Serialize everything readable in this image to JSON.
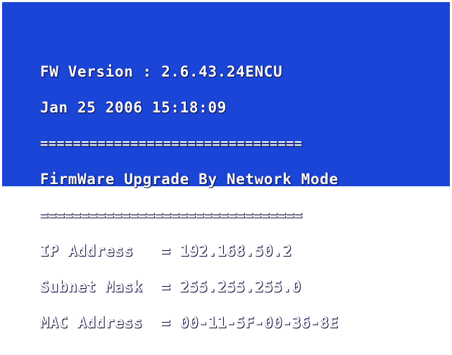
{
  "colors": {
    "background": "#1a45d6",
    "text": "#ffffff",
    "frame": "#ffffff"
  },
  "console": {
    "lines": {
      "fw_version": "FW Version : 2.6.43.24ENCU",
      "timestamp": "Jan 25 2006 15:18:09",
      "divider_top": "================================",
      "mode_title": "FirmWare Upgrade By Network Mode",
      "divider_bottom": "================================",
      "ip_address": "IP Address   = 192.168.50.2",
      "subnet_mask": "Subnet Mask  = 255.255.255.0",
      "mac_address": "MAC Address  = 00-11-5F-00-36-8E"
    }
  }
}
